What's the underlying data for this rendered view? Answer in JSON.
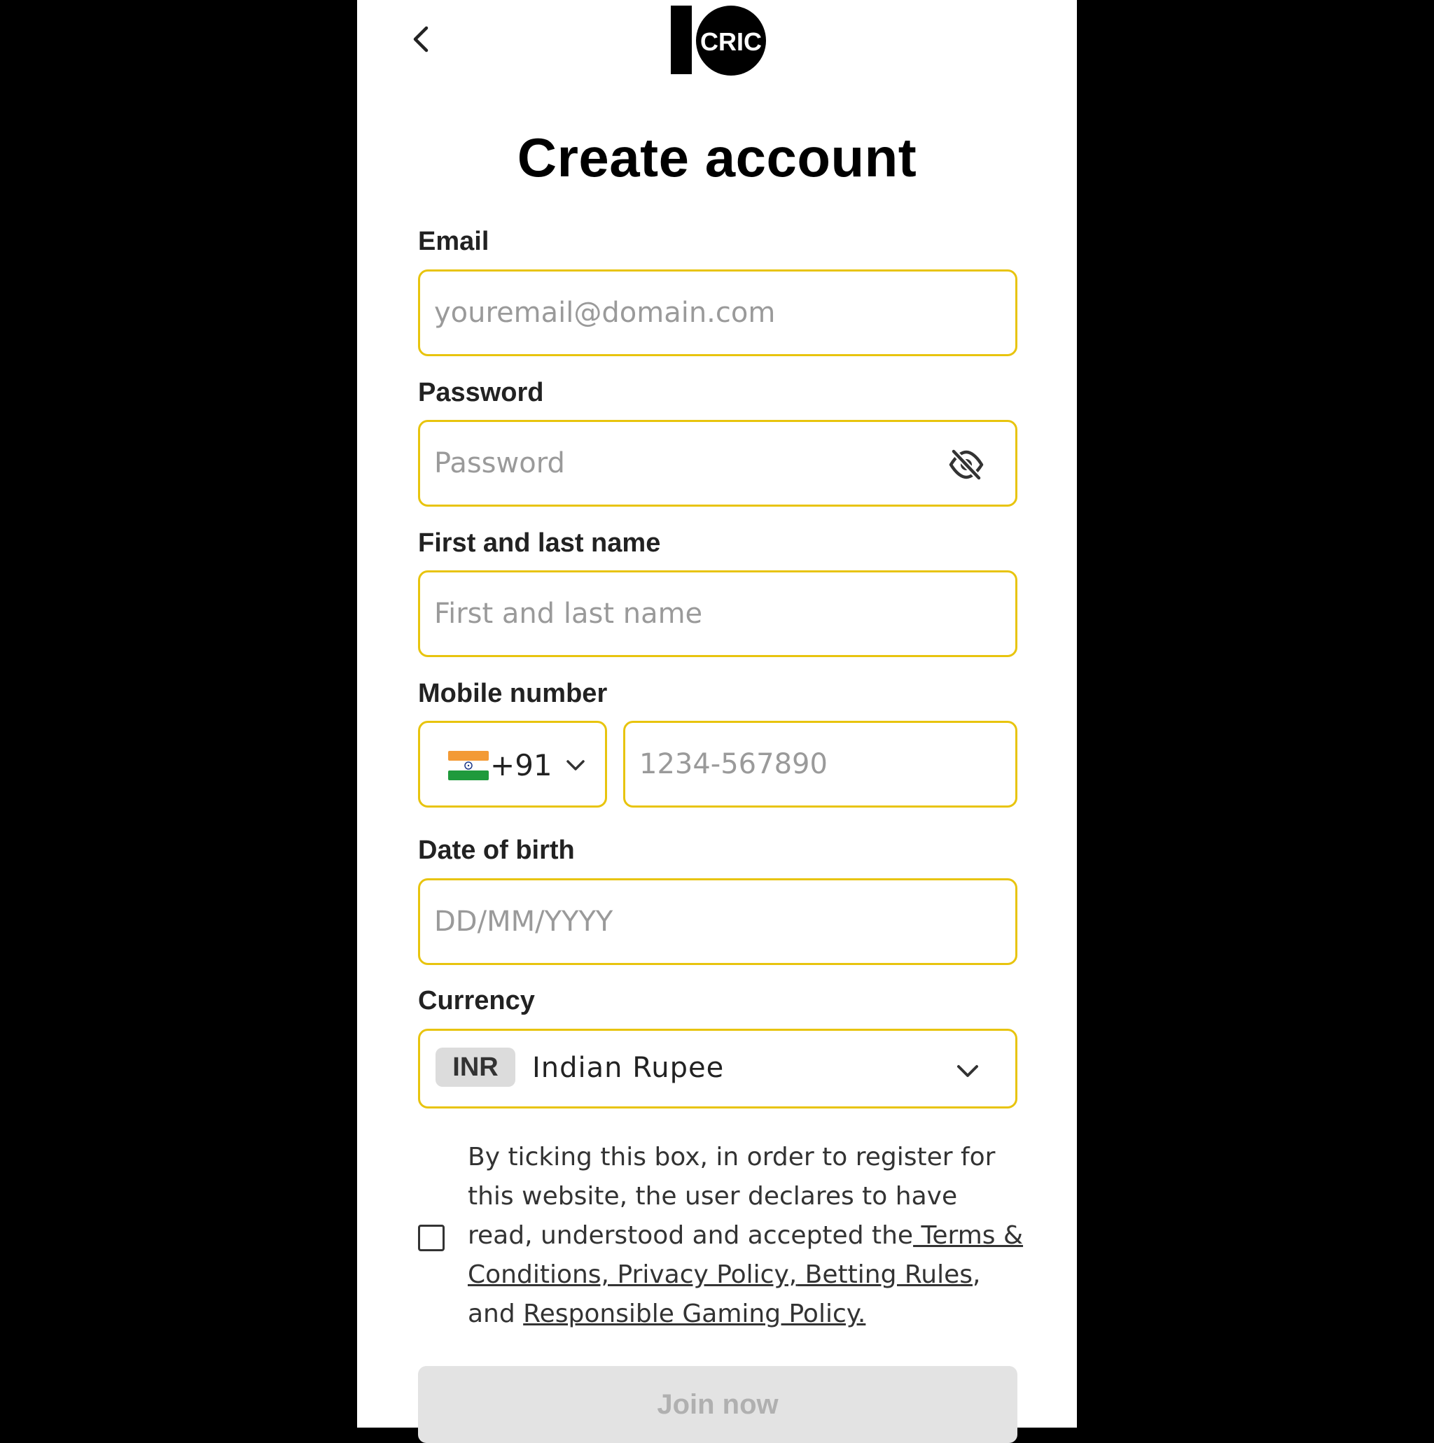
{
  "header": {
    "back_icon": "chevron-left-icon",
    "logo_text": "CRIC",
    "logo_mark": "10"
  },
  "title": "Create account",
  "form": {
    "email": {
      "label": "Email",
      "placeholder": "youremail@domain.com"
    },
    "password": {
      "label": "Password",
      "placeholder": "Password",
      "toggle_icon": "eye-off-icon"
    },
    "name": {
      "label": "First and last name",
      "placeholder": "First and last name"
    },
    "mobile": {
      "label": "Mobile number",
      "country_code": "+91",
      "country_flag": "india-flag-icon",
      "placeholder": "1234-567890"
    },
    "dob": {
      "label": "Date of birth",
      "placeholder": "DD/MM/YYYY"
    },
    "currency": {
      "label": "Currency",
      "code": "INR",
      "name": "Indian Rupee"
    }
  },
  "consent": {
    "text_before": "By ticking this box, in order to register for this website, the user declares to have read, understood and accepted the",
    "link_terms": " Terms & Conditions,",
    "link_privacy": " Privacy Policy,",
    "link_betting": " Betting Rules",
    "text_and": ", and ",
    "link_responsible": "Responsible Gaming Policy."
  },
  "submit_label": "Join now",
  "colors": {
    "field_border": "#e8c40e",
    "button_disabled_bg": "#e3e3e3",
    "button_disabled_text": "#b0b0b0"
  }
}
